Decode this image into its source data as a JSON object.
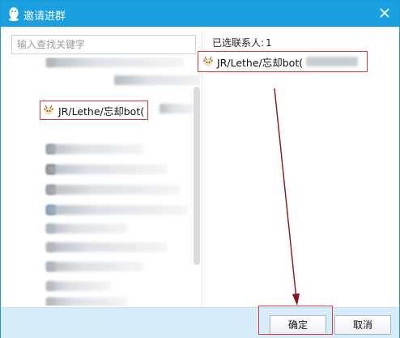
{
  "window": {
    "title": "邀请进群",
    "close_glyph": "✕"
  },
  "search": {
    "placeholder": "输入查找关键字"
  },
  "contacts": {
    "selected_name": "JR/Lethe/忘却bot("
  },
  "selection": {
    "count_label": "已选联系人:",
    "count_value": "1",
    "item_name": "JR/Lethe/忘却bot("
  },
  "footer": {
    "ok_label": "确定",
    "cancel_label": "取消"
  },
  "colors": {
    "title_bar": "#1aa0e0",
    "footer_bg": "#d6ecf8",
    "highlight_border": "#e03b3b",
    "arrow": "#8b1020"
  }
}
